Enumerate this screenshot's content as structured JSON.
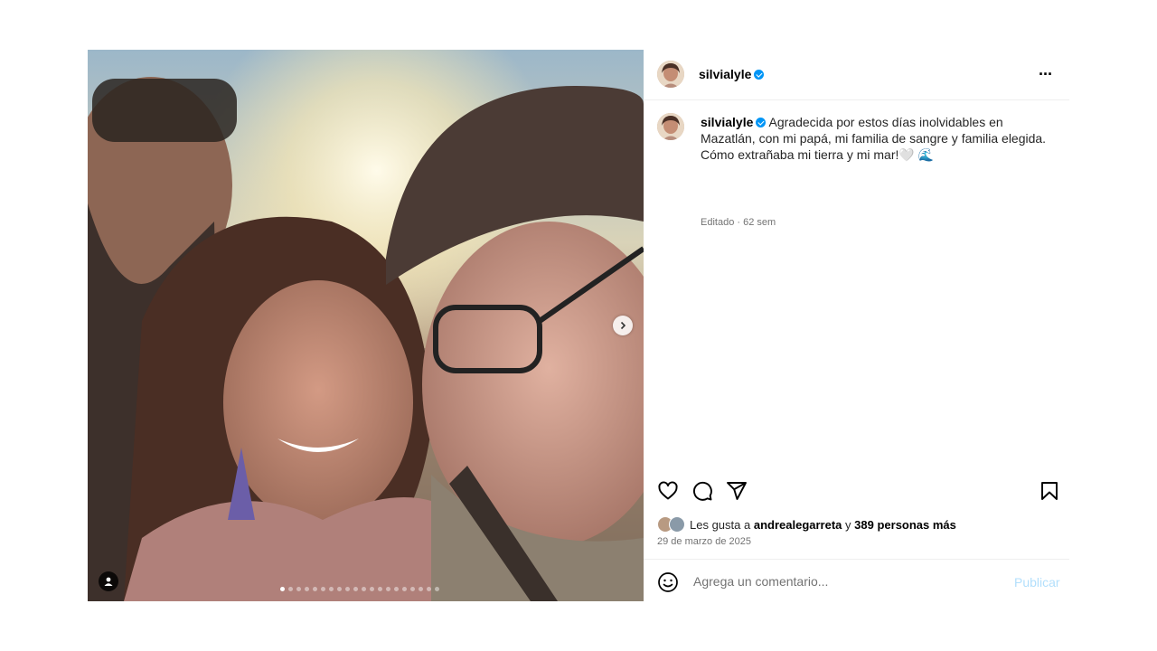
{
  "post": {
    "username": "silvialyle",
    "more_label": "···",
    "caption": "Agradecida por estos días inolvidables en Mazatlán, con mi papá, mi familia de sangre y familia elegida. Cómo extrañaba mi tierra y mi mar!",
    "caption_emojis": "🤍 🌊",
    "edited": "Editado · 62 sem",
    "likes_prefix": "Les gusta a",
    "likes_user": "andrealegarreta",
    "likes_join": "y",
    "likes_others": "389 personas más",
    "date": "29 de marzo de 2025"
  },
  "carousel": {
    "total": 20,
    "active_index": 0
  },
  "comment": {
    "placeholder": "Agrega un comentario...",
    "publish_label": "Publicar"
  },
  "icons": [
    "heart-icon",
    "comment-icon",
    "share-icon",
    "bookmark-icon",
    "emoji-icon",
    "chevron-right-icon",
    "user-tag-icon",
    "verified-badge-icon",
    "more-options-icon"
  ],
  "colors": {
    "verified": "#0095f6",
    "publish_disabled": "#b2dffc",
    "muted_text": "#737373"
  }
}
